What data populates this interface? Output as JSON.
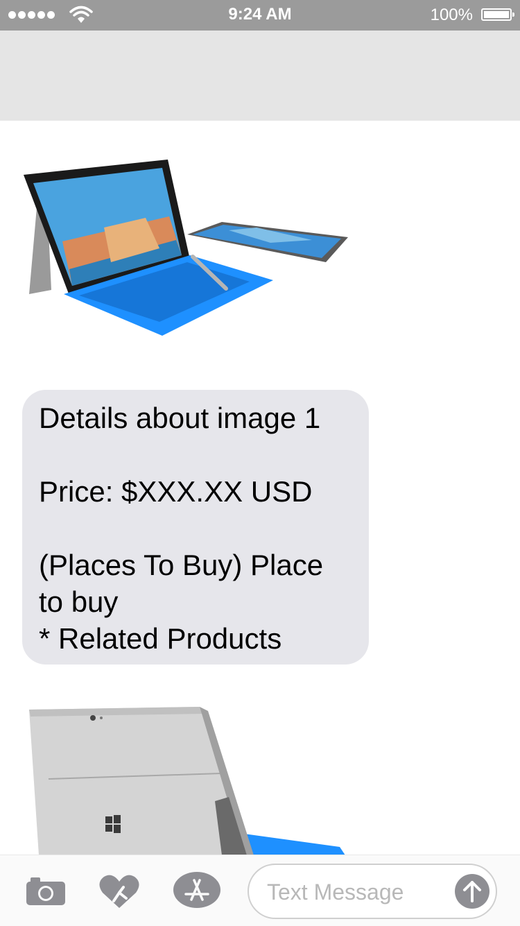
{
  "status": {
    "time": "9:24 AM",
    "battery": "100%"
  },
  "messages": {
    "bubble_lines": [
      "Details about image 1",
      "Price: $XXX.XX USD",
      "(Places To Buy) Place to buy",
      "* Related Products"
    ]
  },
  "composer": {
    "placeholder": "Text Message"
  },
  "icons": {
    "signal": "signal-dots-icon",
    "wifi": "wifi-icon",
    "battery": "battery-icon",
    "camera": "camera-icon",
    "digital_touch": "heart-hands-icon",
    "app_store": "app-store-icon",
    "send": "arrow-up-icon"
  },
  "colors": {
    "status_bar": "#9b9b9b",
    "nav_bar": "#e5e5e5",
    "bubble": "#e6e6eb",
    "icon_gray": "#8e8e93",
    "keyboard_blue": "#1e90ff"
  }
}
